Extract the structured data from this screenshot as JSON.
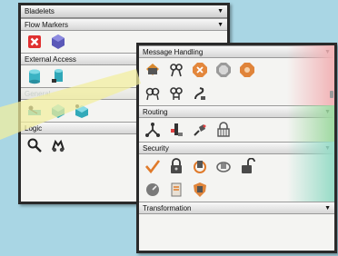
{
  "left_panel": {
    "title": "Bladelets",
    "sections": [
      {
        "label": "Flow Markers",
        "icons": [
          "stop-icon",
          "hexagon-icon"
        ]
      },
      {
        "label": "External Access",
        "icons": [
          "cylinder-icon",
          "database-icon"
        ]
      },
      {
        "label": "General",
        "icons": [
          "connector-icon",
          "cube-icon",
          "cube-alt-icon"
        ]
      },
      {
        "label": "Logic",
        "icons": [
          "magnifier-icon",
          "binoculars-icon"
        ]
      }
    ]
  },
  "right_panel": {
    "sections": [
      {
        "label": "Message Handling",
        "icons": [
          "envelope-icon",
          "branch-icon",
          "stop-sign-icon",
          "octagon-icon",
          "splitter-icon",
          "rings-icon",
          "branch-alt-icon",
          "ribbon-icon"
        ]
      },
      {
        "label": "Routing",
        "icons": [
          "fork-icon",
          "router-icon",
          "paint-bucket-icon",
          "padlock-grid-icon"
        ]
      },
      {
        "label": "Security",
        "icons": [
          "check-icon",
          "lock-icon",
          "lock-shield-icon",
          "lock-key-icon",
          "open-lock-icon",
          "gauge-icon",
          "scroll-icon",
          "shield-icon"
        ]
      },
      {
        "label": "Transformation",
        "icons": []
      }
    ]
  },
  "colors": {
    "background": "#a9d6e4",
    "panel_border": "#2a2a2a",
    "highlight_beam": "#f3ee9c",
    "message_band": "#f2b3b6",
    "routing_band": "#9fd9a2",
    "security_band": "#97dcc7"
  }
}
